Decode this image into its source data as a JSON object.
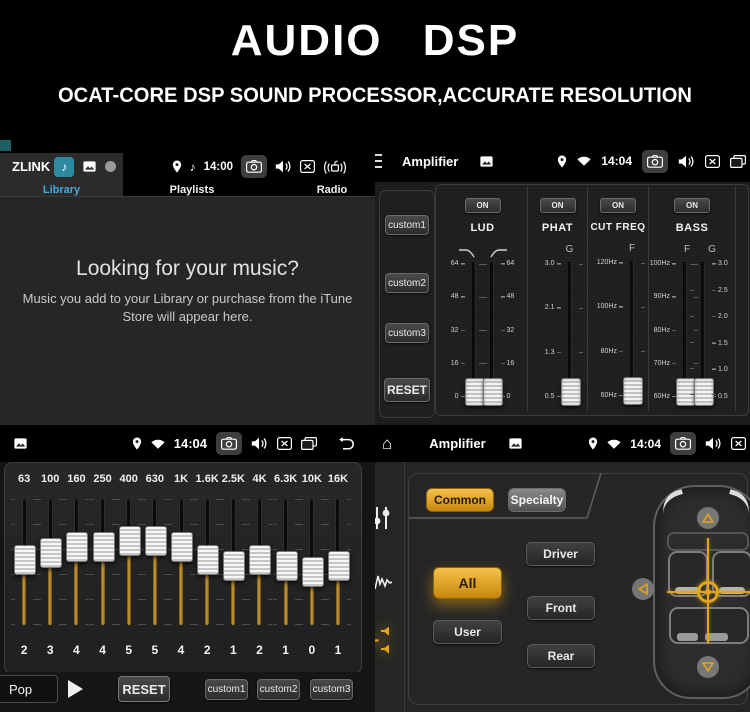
{
  "header": {
    "title": "AUDIO DSP",
    "subtitle": "OCAT-CORE DSP SOUND PROCESSOR,ACCURATE RESOLUTION"
  },
  "icons": {
    "home": "⌂",
    "music_note": "♪"
  },
  "colors": {
    "accent_gold": "#e2a51d",
    "accent_cyan": "#4aa8d8",
    "brand_teal": "#2e8aa0"
  },
  "music": {
    "brand": "ZLINK",
    "time": "14:00",
    "tabs": [
      {
        "label": "Library",
        "active": true
      },
      {
        "label": "Playlists",
        "active": false
      },
      {
        "label": "Radio",
        "active": false
      }
    ],
    "empty_title": "Looking for your music?",
    "empty_line1": "Music you add to your Library or purchase from the iTune",
    "empty_line2": "Store will appear here."
  },
  "amp": {
    "title": "Amplifier",
    "time": "14:04",
    "on_label": "ON",
    "presets": [
      "custom1",
      "custom2",
      "custom3"
    ],
    "reset": "RESET",
    "columns": [
      {
        "name": "LUD",
        "sliders": [
          {
            "scale": [
              "64",
              "48",
              "32",
              "16",
              "0"
            ]
          },
          {
            "scale": [
              "64",
              "48",
              "32",
              "16",
              "0"
            ]
          }
        ]
      },
      {
        "name": "PHAT",
        "sub": "G",
        "sliders": [
          {
            "scale": [
              "3.0",
              "2.1",
              "1.3",
              "0.5"
            ]
          }
        ]
      },
      {
        "name": "CUT FREQ",
        "sub": "F",
        "sliders": [
          {
            "scale": [
              "120Hz",
              "100Hz",
              "80Hz",
              "60Hz"
            ]
          }
        ]
      },
      {
        "name": "BASS",
        "subs": [
          "F",
          "G"
        ],
        "sliders": [
          {
            "scale": [
              "100Hz",
              "90Hz",
              "80Hz",
              "70Hz",
              "60Hz"
            ]
          },
          {
            "scale": [
              "3.0",
              "2.5",
              "2.0",
              "1.5",
              "1.0",
              "0.5"
            ]
          }
        ]
      }
    ]
  },
  "eq": {
    "time": "14:04",
    "preset": "Pop",
    "reset": "RESET",
    "customs": [
      "custom1",
      "custom2",
      "custom3"
    ],
    "bands": [
      {
        "freq": "63",
        "value": 2
      },
      {
        "freq": "100",
        "value": 3
      },
      {
        "freq": "160",
        "value": 4
      },
      {
        "freq": "250",
        "value": 4
      },
      {
        "freq": "400",
        "value": 5
      },
      {
        "freq": "630",
        "value": 5
      },
      {
        "freq": "1K",
        "value": 4
      },
      {
        "freq": "1.6K",
        "value": 2
      },
      {
        "freq": "2.5K",
        "value": 1
      },
      {
        "freq": "4K",
        "value": 2
      },
      {
        "freq": "6.3K",
        "value": 1
      },
      {
        "freq": "10K",
        "value": 0
      },
      {
        "freq": "16K",
        "value": 1
      }
    ]
  },
  "fader": {
    "title": "Amplifier",
    "time": "14:04",
    "tabs": [
      {
        "label": "Common",
        "active": true
      },
      {
        "label": "Specialty",
        "active": false
      }
    ],
    "zones": {
      "all": "All",
      "driver": "Driver",
      "front": "Front",
      "user": "User",
      "rear": "Rear"
    }
  }
}
